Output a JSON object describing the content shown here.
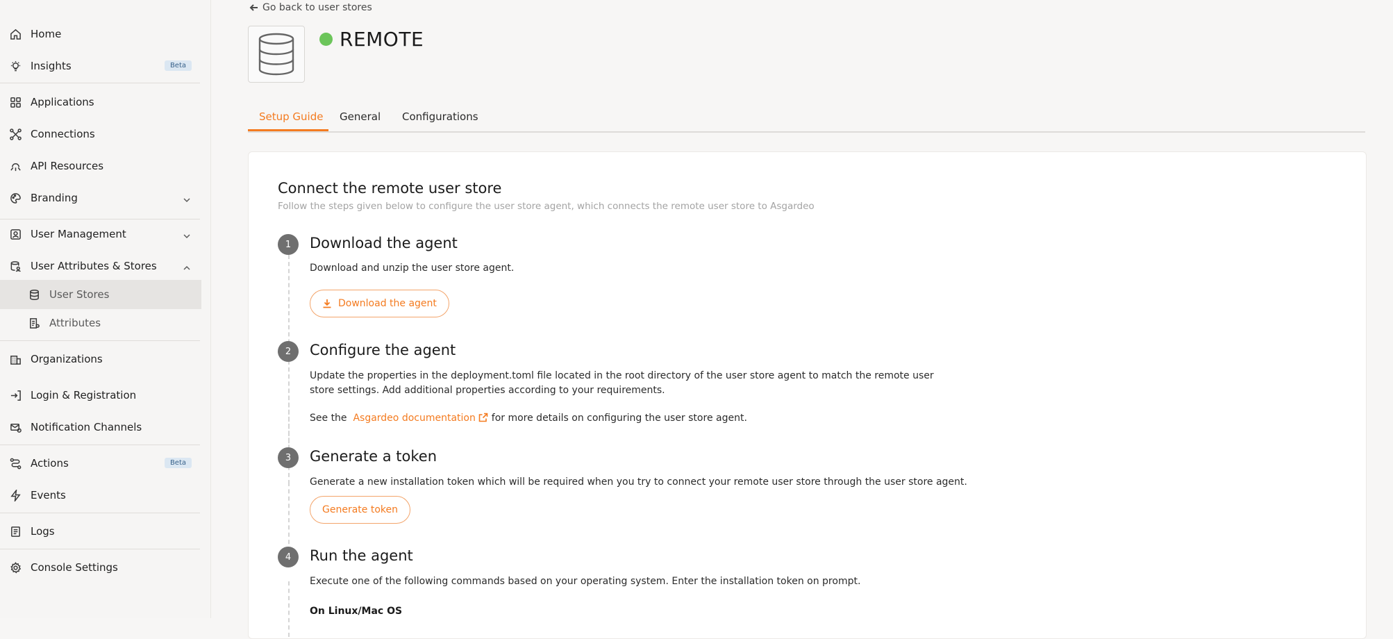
{
  "sidebar": {
    "items": [
      {
        "label": "Home",
        "icon": "home-icon"
      },
      {
        "label": "Insights",
        "icon": "lightbulb-icon",
        "badge": "Beta"
      },
      {
        "label": "Applications",
        "icon": "apps-grid-icon"
      },
      {
        "label": "Connections",
        "icon": "connections-icon"
      },
      {
        "label": "API Resources",
        "icon": "api-resources-icon"
      },
      {
        "label": "Branding",
        "icon": "palette-icon"
      },
      {
        "label": "User Management",
        "icon": "user-management-icon"
      },
      {
        "label": "User Attributes & Stores",
        "icon": "user-attributes-icon"
      },
      {
        "label": "User Stores",
        "icon": "database-icon"
      },
      {
        "label": "Attributes",
        "icon": "attributes-icon"
      },
      {
        "label": "Organizations",
        "icon": "organizations-icon"
      },
      {
        "label": "Login & Registration",
        "icon": "login-registration-icon"
      },
      {
        "label": "Notification Channels",
        "icon": "notification-channels-icon"
      },
      {
        "label": "Actions",
        "icon": "actions-icon",
        "badge": "Beta"
      },
      {
        "label": "Events",
        "icon": "lightning-icon"
      },
      {
        "label": "Logs",
        "icon": "logs-icon"
      },
      {
        "label": "Console Settings",
        "icon": "gear-icon"
      }
    ]
  },
  "header": {
    "back_label": "Go back to user stores",
    "title": "REMOTE",
    "status_color": "#6cc55a"
  },
  "tabs": [
    {
      "label": "Setup Guide",
      "active": true
    },
    {
      "label": "General",
      "active": false
    },
    {
      "label": "Configurations",
      "active": false
    }
  ],
  "guide": {
    "title": "Connect the remote user store",
    "subtitle": "Follow the steps given below to configure the user store agent, which connects the remote user store to Asgardeo",
    "steps": [
      {
        "number": "1",
        "title": "Download the agent",
        "text": "Download and unzip the user store agent.",
        "button": "Download the agent"
      },
      {
        "number": "2",
        "title": "Configure the agent",
        "text": "Update the properties in the deployment.toml file located in the root directory of the user store agent to match the remote user store settings. Add additional properties according to your requirements.",
        "see_prefix": "See the",
        "doc_link": "Asgardeo documentation",
        "see_suffix": "for more details on configuring the user store agent."
      },
      {
        "number": "3",
        "title": "Generate a token",
        "text": "Generate a new installation token which will be required when you try to connect your remote user store through the user store agent.",
        "button": "Generate token"
      },
      {
        "number": "4",
        "title": "Run the agent",
        "text": "Execute one of the following commands based on your operating system. Enter the installation token on prompt.",
        "os_label": "On Linux/Mac OS"
      }
    ]
  },
  "colors": {
    "accent": "#f47b20",
    "badge_bg": "#dbe7f2",
    "badge_text": "#39628a"
  }
}
